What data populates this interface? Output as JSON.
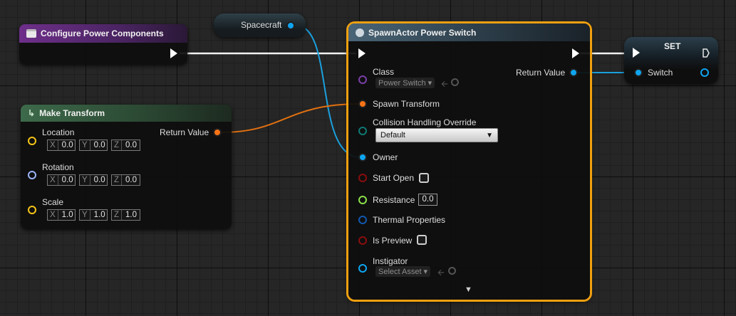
{
  "nodes": {
    "configure": {
      "title": "Configure Power Components"
    },
    "make_transform": {
      "title": "Make Transform",
      "return_label": "Return Value",
      "location": {
        "label": "Location",
        "x_axis": "X",
        "y_axis": "Y",
        "z_axis": "Z",
        "x": "0.0",
        "y": "0.0",
        "z": "0.0"
      },
      "rotation": {
        "label": "Rotation",
        "x_axis": "X",
        "y_axis": "Y",
        "z_axis": "Z",
        "x": "0.0",
        "y": "0.0",
        "z": "0.0"
      },
      "scale": {
        "label": "Scale",
        "x_axis": "X",
        "y_axis": "Y",
        "z_axis": "Z",
        "x": "1.0",
        "y": "1.0",
        "z": "1.0"
      }
    },
    "spacecraft": {
      "label": "Spacecraft"
    },
    "spawn": {
      "title": "SpawnActor Power Switch",
      "class_label": "Class",
      "class_value": "Power Switch",
      "return_label": "Return Value",
      "spawn_transform_label": "Spawn Transform",
      "collision_label": "Collision Handling Override",
      "collision_value": "Default",
      "owner_label": "Owner",
      "start_open_label": "Start Open",
      "resistance_label": "Resistance",
      "resistance_value": "0.0",
      "thermal_label": "Thermal Properties",
      "is_preview_label": "Is Preview",
      "instigator_label": "Instigator",
      "instigator_value": "Select Asset"
    },
    "set": {
      "title": "SET",
      "switch_label": "Switch"
    }
  },
  "colors": {
    "exec_wire": "#ffffff",
    "object_pin": "#0ea5f0",
    "struct_pin": "#f97316",
    "vector_pin": "#f5c518",
    "rotator_pin": "#9bb4f5",
    "selection": "#f0a010"
  },
  "icons": {
    "configure": "function-icon",
    "make_transform": "pure-function-icon",
    "spawn": "spawn-actor-icon",
    "dropdown": "chevron-down-icon",
    "browse": "browse-asset-icon",
    "use": "use-selected-arrow-icon",
    "expand": "expand-advanced-icon"
  }
}
